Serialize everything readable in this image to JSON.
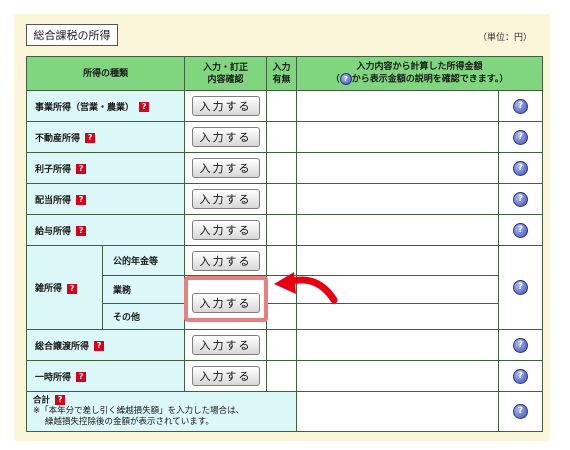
{
  "section_title": "総合課税の所得",
  "unit_label": "（単位：円）",
  "table": {
    "header": {
      "kind": "所得の種類",
      "input_correct_line1": "入力・訂正",
      "input_correct_line2": "内容確認",
      "has_input_line1": "入力",
      "has_input_line2": "有無",
      "amount_line1": "入力内容から計算した所得金額",
      "amount_prefix": "（",
      "amount_line2": "から表示金額の説明を確認できます。）"
    },
    "button_label": "入力する",
    "rows": [
      {
        "label": "事業所得（営業・農業）"
      },
      {
        "label": "不動産所得"
      },
      {
        "label": "利子所得"
      },
      {
        "label": "配当所得"
      },
      {
        "label": "給与所得"
      }
    ],
    "misc": {
      "label": "雑所得",
      "sub": [
        "公的年金等",
        "業務",
        "その他"
      ]
    },
    "rows_after": [
      {
        "label": "総合譲渡所得"
      },
      {
        "label": "一時所得"
      }
    ],
    "total": {
      "label": "合計",
      "note_line1": "※「本年分で差し引く繰越損失額」を入力した場合は、",
      "note_line2": "繰越損失控除後の金額が表示されています。"
    },
    "qmark_text": "?",
    "help_icon_text": "?"
  },
  "colors": {
    "panel_bg": "#fbf5d9",
    "header_bg": "#7fd67f",
    "category_bg": "#dcf7f7",
    "question_red": "#d8001a",
    "highlight": "#e98080",
    "arrow_red": "#e60012"
  },
  "icons": {
    "question": "red-question-mark-icon",
    "help": "blue-help-bubble-icon",
    "arrow": "curved-red-arrow-icon"
  }
}
